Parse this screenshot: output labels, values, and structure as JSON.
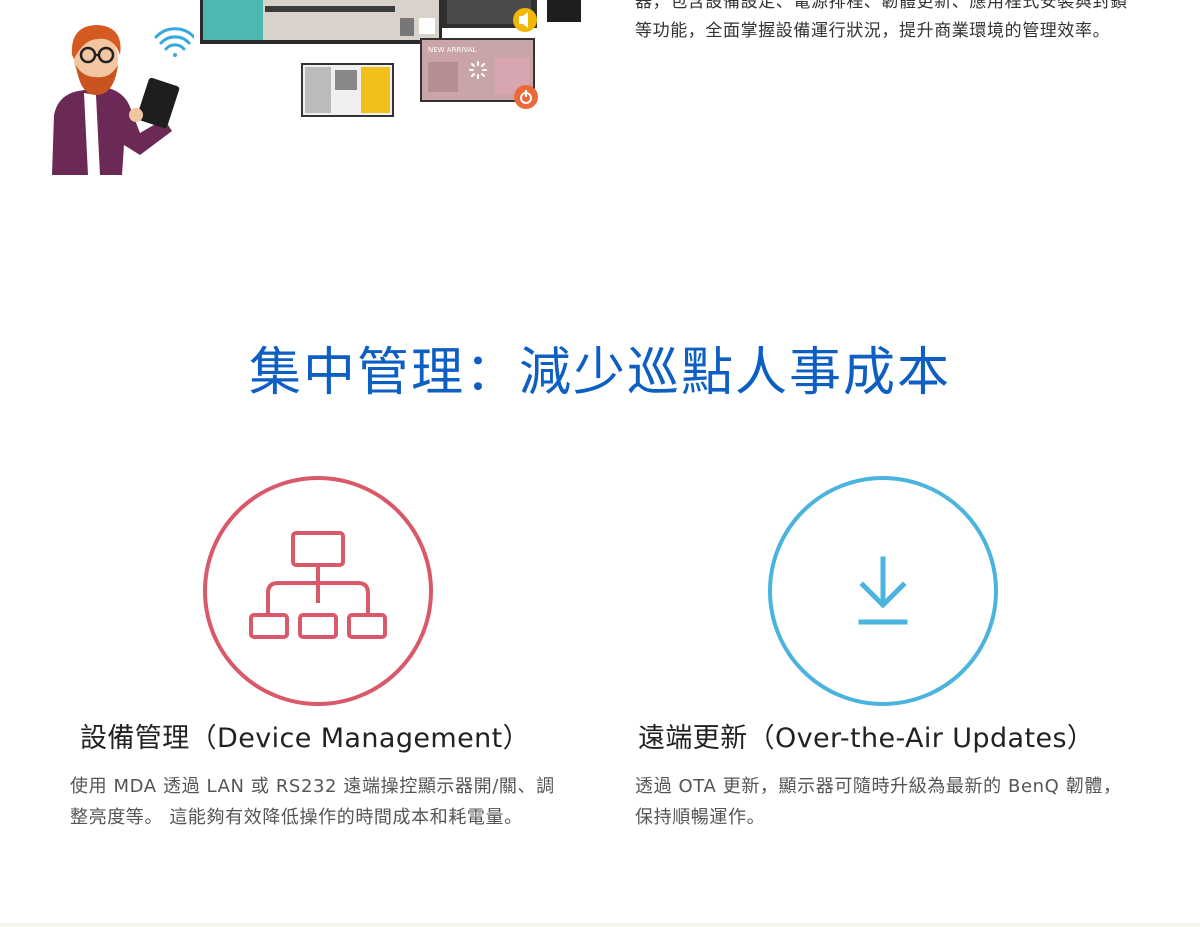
{
  "hero": {
    "text": "器，包含設備設定、電源排程、韌體更新、應用程式安裝與封鎖等功能，全面掌握設備運行狀況，提升商業環境的管理效率。",
    "screen_banner": "NEW ARRIVAL"
  },
  "section": {
    "title": "集中管理：減少巡點人事成本"
  },
  "features": [
    {
      "heading": "設備管理（Device Management）",
      "description": "使用 MDA 透過 LAN 或 RS232 遠端操控顯示器開/關、調整亮度等。 這能夠有效降低操作的時間成本和耗電量。",
      "icon": "sitemap-icon",
      "color": "#d9596a"
    },
    {
      "heading": "遠端更新（Over-the-Air Updates）",
      "description": "透過 OTA 更新，顯示器可隨時升級為最新的 BenQ 韌體，保持順暢運作。",
      "icon": "download-icon",
      "color": "#4ab3de"
    }
  ]
}
